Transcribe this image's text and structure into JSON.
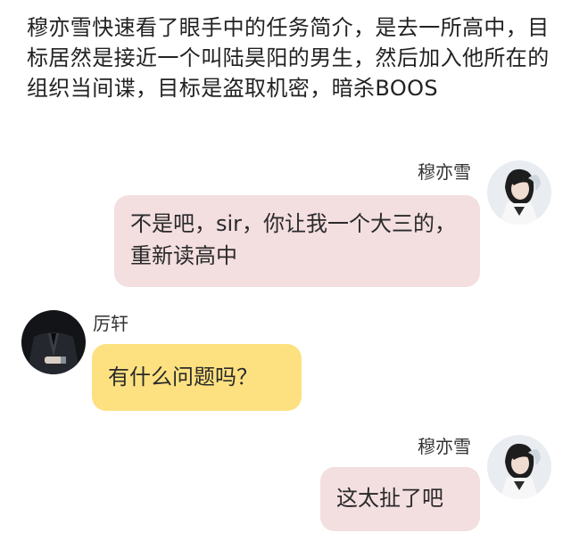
{
  "narration": "穆亦雪快速看了眼手中的任务简介，是去一所高中，目标居然是接近一个叫陆昊阳的男生，然后加入他所在的组织当间谍，目标是盗取机密，暗杀BOOS",
  "messages": [
    {
      "sender": "穆亦雪",
      "text": "不是吧，sir，你让我一个大三的，重新读高中"
    },
    {
      "sender": "厉轩",
      "text": "有什么问题吗？"
    },
    {
      "sender": "穆亦雪",
      "text": "这太扯了吧"
    }
  ],
  "colors": {
    "right_bubble": "#f3dee0",
    "left_bubble": "#fde181"
  }
}
